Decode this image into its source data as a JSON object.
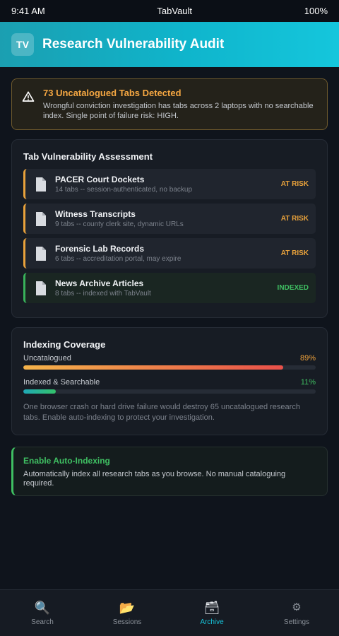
{
  "status_bar": {
    "time": "9:41 AM",
    "carrier": "TabVault",
    "battery": "100%"
  },
  "header": {
    "logo": "TV",
    "title": "Research Vulnerability Audit"
  },
  "alert": {
    "icon": "warning-icon",
    "title": "73 Uncatalogued Tabs Detected",
    "text": "Wrongful conviction investigation has tabs across 2 laptops with no searchable index. Single point of failure risk: HIGH."
  },
  "assessment": {
    "title": "Tab Vulnerability Assessment",
    "items": [
      {
        "name": "PACER Court Dockets",
        "desc": "14 tabs -- session-authenticated, no backup",
        "status": "AT RISK"
      },
      {
        "name": "Witness Transcripts",
        "desc": "9 tabs -- county clerk site, dynamic URLs",
        "status": "AT RISK"
      },
      {
        "name": "Forensic Lab Records",
        "desc": "6 tabs -- accreditation portal, may expire",
        "status": "AT RISK"
      },
      {
        "name": "News Archive Articles",
        "desc": "8 tabs -- indexed with TabVault",
        "status": "INDEXED"
      }
    ]
  },
  "coverage": {
    "title": "Indexing Coverage",
    "uncatalogued_label": "Uncatalogued",
    "uncatalogued_pct": "89%",
    "uncatalogued_value": 0.89,
    "indexed_label": "Indexed & Searchable",
    "indexed_pct": "11%",
    "indexed_value": 0.11,
    "note": "One browser crash or hard drive failure would destroy 65 uncatalogued research tabs. Enable auto-indexing to protect your investigation."
  },
  "cta": {
    "title": "Enable Auto-Indexing",
    "text": "Automatically index all research tabs as you browse. No manual cataloguing required."
  },
  "tabs": [
    {
      "label": "Search",
      "icon": "🔍"
    },
    {
      "label": "Sessions",
      "icon": "📂"
    },
    {
      "label": "Archive",
      "icon": "🗃"
    },
    {
      "label": "Settings",
      "icon": "⚙"
    }
  ],
  "active_tab": "Archive",
  "colors": {
    "accent": "#16c2d8",
    "warning": "#e9a23b",
    "success": "#3fbf62"
  }
}
